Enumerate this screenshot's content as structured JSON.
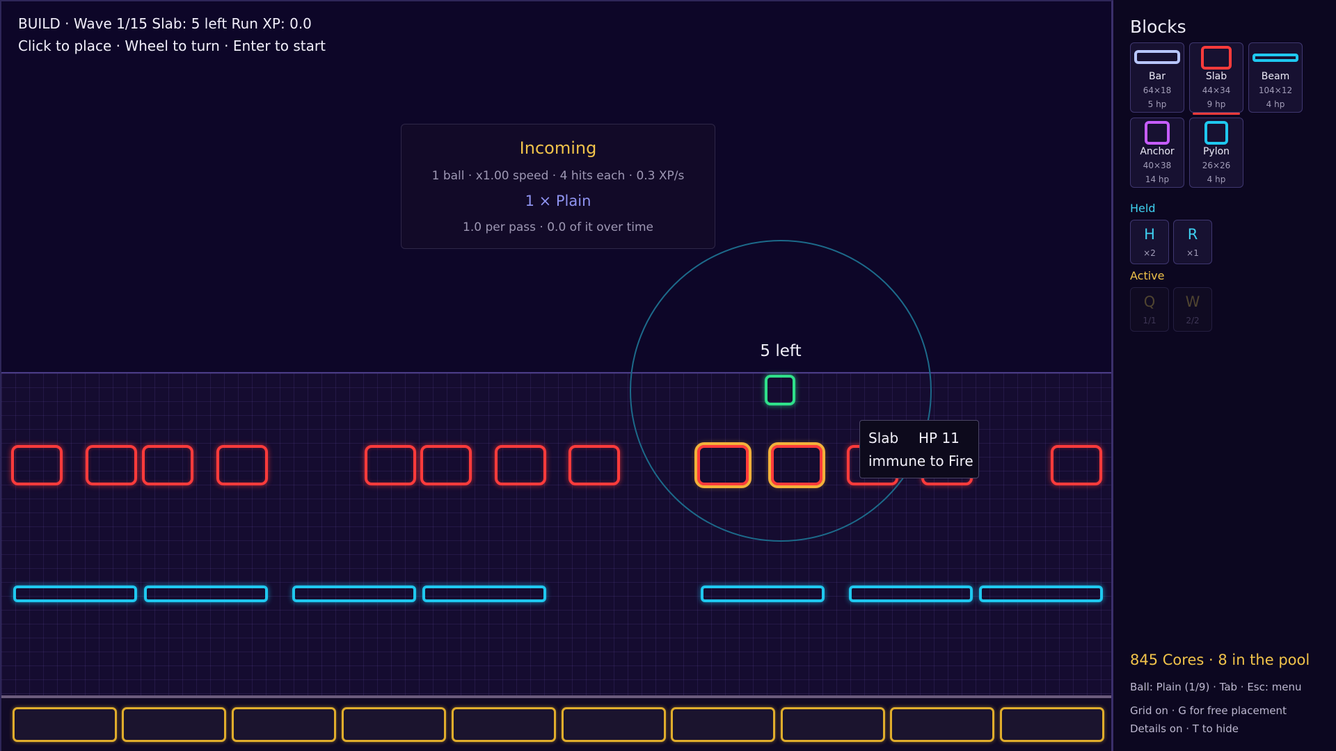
{
  "hud": {
    "status": "BUILD · Wave 1/15   Slab: 5 left   Run XP: 0.0",
    "controls": "Click to place · Wheel to turn · Enter to start"
  },
  "incoming": {
    "title": "Incoming",
    "stats": "1 ball  ·  x1.00 speed  ·  4 hits each  ·  0.3 XP/s",
    "ball_type": "1 ×  Plain",
    "detail": "1.0 per pass  ·  0.0 of it over time"
  },
  "placement": {
    "remaining_label": "5 left",
    "ghost_color": "#2fe08a"
  },
  "tooltip": {
    "name": "Slab",
    "hp": "HP 11",
    "resist": "immune to Fire"
  },
  "sidebar": {
    "title": "Blocks",
    "blocks": [
      {
        "name": "Bar",
        "size": "64×18",
        "hp": "5 hp",
        "color": "#b8c6ff",
        "icon": "bar-icon"
      },
      {
        "name": "Slab",
        "size": "44×34",
        "hp": "9 hp",
        "color": "#ff3b3b",
        "icon": "slab-icon",
        "selected": true
      },
      {
        "name": "Beam",
        "size": "104×12",
        "hp": "4 hp",
        "color": "#1fc8ef",
        "icon": "beam-icon"
      },
      {
        "name": "Anchor",
        "size": "40×38",
        "hp": "14 hp",
        "color": "#c65cff",
        "icon": "anchor-icon"
      },
      {
        "name": "Pylon",
        "size": "26×26",
        "hp": "4 hp",
        "color": "#1fc8ef",
        "icon": "pylon-icon"
      }
    ],
    "held_label": "Held",
    "held": [
      {
        "key": "H",
        "count": "×2"
      },
      {
        "key": "R",
        "count": "×1"
      }
    ],
    "active_label": "Active",
    "active": [
      {
        "key": "Q",
        "count": "1/1"
      },
      {
        "key": "W",
        "count": "2/2"
      }
    ],
    "cores": "845 Cores  ·  8 in the pool",
    "ball_info": "Ball: Plain (1/9) · Tab   ·   Esc: menu",
    "grid_info": "Grid on · G for free placement",
    "details_info": "Details on · T to hide"
  },
  "colors": {
    "slab": "#ff3b3b",
    "beam": "#1fc8ef",
    "floor": "#e0ad2c",
    "accent_gold": "#f0c24a",
    "accent_cyan": "#3fd0f0"
  }
}
